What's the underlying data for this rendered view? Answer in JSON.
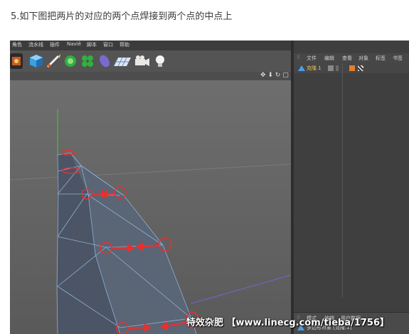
{
  "caption": "5.如下图把两片的对应的两个点焊接到两个点的中点上",
  "menubar": {
    "items": [
      "角色",
      "流水线",
      "插件",
      "Naviê",
      "脚本",
      "窗口",
      "帮助"
    ]
  },
  "toolbar": {
    "icons": [
      "character-icon",
      "cube-icon",
      "pen-icon",
      "subdivision-icon",
      "cloner-icon",
      "deformer-icon",
      "floor-icon",
      "camera-icon",
      "light-icon"
    ]
  },
  "viewport": {
    "nav_glyphs": "✥ ⬇ ↻ ▢"
  },
  "object_manager": {
    "menu": [
      "文件",
      "编辑",
      "查看",
      "对象",
      "标签",
      "书签"
    ],
    "object_name": "克隆.1"
  },
  "attributes": {
    "menu": [
      "模式",
      "编辑",
      "用户数据"
    ],
    "object_label": "多边形对象 [克隆.1]"
  },
  "watermark": "特效杂肥 【www.linecg.com/tieba/1756】",
  "colors": {
    "mesh_fill": "#4f5a6a",
    "mesh_fill_right": "#5a6575",
    "mesh_edge": "#8fb0d8",
    "annotation": "#e83030",
    "axis_y": "#3fbf3f",
    "axis_line": "#6a6acf",
    "selected_object": "#e8c84a"
  }
}
